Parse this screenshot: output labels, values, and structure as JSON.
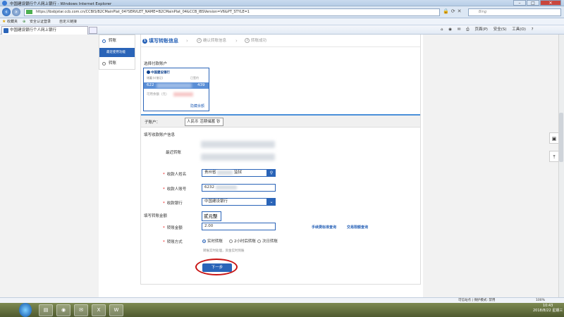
{
  "window": {
    "title": "中国建设银行个人网上银行 - Windows Internet Explorer"
  },
  "address": {
    "url": "https://ibsbjstar.ccb.com.cn/CCBIS/B2CMainPlat_04?SERVLET_NAME=B2CMainPlat_04&CCB_IBSVersion=V6&PT_STYLE=1",
    "search_placeholder": "Bing"
  },
  "favorites": {
    "label": "收藏夹",
    "items": [
      "安全认证登录",
      "自定义链接"
    ]
  },
  "tab": {
    "title": "中国建设银行个人网上银行"
  },
  "commandbar": {
    "page": "页面(P)",
    "safety": "安全(S)",
    "tools": "工具(O)",
    "help": "?"
  },
  "sidenav": {
    "transfer": "转账",
    "recent": "最近使用功能",
    "transfer2": "转账"
  },
  "steps": [
    "填写转账信息",
    "确认转账信息",
    "转账成功"
  ],
  "payer": {
    "section": "选择付款账户",
    "bank_logo": "中国建设银行",
    "card_prefix": "622",
    "card_suffix": "439",
    "small_left": "储蓄卡(借记)",
    "small_right": "已签约",
    "balance_label": "可用余额（元）",
    "hide_balance": "隐藏余额"
  },
  "sub_account": {
    "label": "子账户：",
    "value": "人民币 活期储蓄 钞"
  },
  "payee": {
    "section": "填写收款账户信息",
    "recent_label": "最近转账",
    "name_label": "收款人姓名",
    "name_value": "贵州省",
    "name_value_right": "监狱",
    "account_label": "收款人账号",
    "account_value": "6232",
    "bank_label": "收款银行",
    "bank_value": "中国建设银行"
  },
  "amount": {
    "section": "填写转账金额",
    "label": "转账金额",
    "value": "2.00",
    "tooltip": "贰元整",
    "fee_link": "手续费标准查询",
    "limit_link": "交易限额查询"
  },
  "method": {
    "label": "转账方式",
    "options": [
      "实时转账",
      "2小时后转账",
      "次日转账"
    ],
    "selected": "实时转账",
    "note": "转账实时处理，资金实时到账"
  },
  "next_button": "下一步",
  "statusbar": {
    "zone": "可信站点 | 保护模式: 禁用",
    "zoom": "100%"
  },
  "clock": {
    "time": "10:43",
    "date": "2018/8/22 星期三"
  },
  "colors": {
    "brand": "#2a64b8",
    "highlight": "#c81414"
  }
}
